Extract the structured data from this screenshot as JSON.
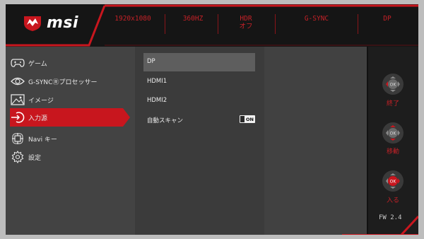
{
  "brand": {
    "name": "msi"
  },
  "status_bar": {
    "resolution": "1920x1080",
    "refresh": "360HZ",
    "hdr_line1": "HDR",
    "hdr_line2": "オフ",
    "sync": "G-SYNC",
    "input": "DP"
  },
  "menu": {
    "items": [
      {
        "label": "ゲーム",
        "icon": "gamepad-icon"
      },
      {
        "label": "G-SYNCⓇプロセッサー",
        "icon": "nvidia-eye-icon"
      },
      {
        "label": "イメージ",
        "icon": "image-icon"
      },
      {
        "label": "入力源",
        "icon": "input-source-icon",
        "active": true
      },
      {
        "label": "Navi キー",
        "icon": "navi-key-icon"
      },
      {
        "label": "設定",
        "icon": "gear-icon"
      }
    ]
  },
  "submenu": {
    "items": [
      {
        "label": "DP",
        "selected": true
      },
      {
        "label": "HDMI1"
      },
      {
        "label": "HDMI2"
      },
      {
        "label": "自動スキャン"
      }
    ],
    "auto_scan_toggle": "ON"
  },
  "navigation_hints": [
    {
      "label": "終了",
      "center": "OK",
      "icon": "joystick-exit-icon"
    },
    {
      "label": "移動",
      "center": "OK",
      "icon": "joystick-move-icon"
    },
    {
      "label": "入る",
      "center": "OK",
      "icon": "joystick-enter-icon"
    }
  ],
  "firmware": "FW 2.4",
  "colors": {
    "accent": "#c8161e",
    "background": "#2b2b2b",
    "panel": "#434343"
  }
}
